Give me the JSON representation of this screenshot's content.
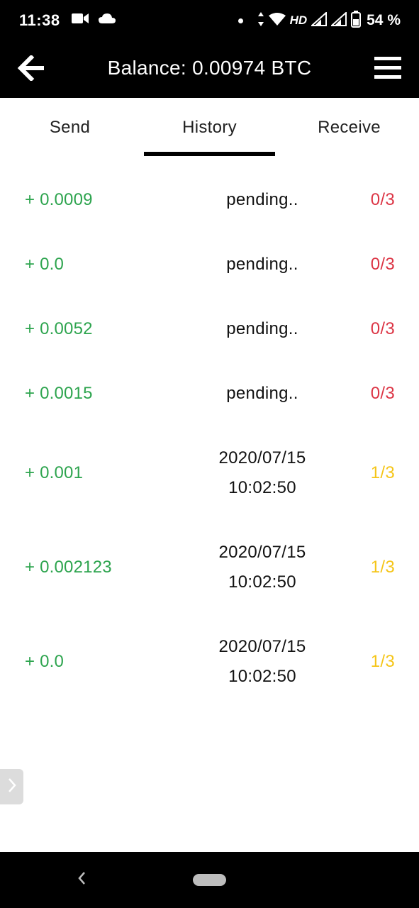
{
  "status_bar": {
    "time": "11:38",
    "hd": "HD",
    "battery": "54 %"
  },
  "app_bar": {
    "title": "Balance: 0.00974 BTC"
  },
  "tabs": [
    {
      "label": "Send",
      "active": false
    },
    {
      "label": "History",
      "active": true
    },
    {
      "label": "Receive",
      "active": false
    }
  ],
  "colors": {
    "amount": "#2da44e",
    "conf_pending": "#dc3545",
    "conf_partial": "#f5c518"
  },
  "transactions": [
    {
      "amount": "+ 0.0009",
      "status": "pending..",
      "confirmations": "0/3",
      "conf_color": "#dc3545"
    },
    {
      "amount": "+ 0.0",
      "status": "pending..",
      "confirmations": "0/3",
      "conf_color": "#dc3545"
    },
    {
      "amount": "+ 0.0052",
      "status": "pending..",
      "confirmations": "0/3",
      "conf_color": "#dc3545"
    },
    {
      "amount": "+ 0.0015",
      "status": "pending..",
      "confirmations": "0/3",
      "conf_color": "#dc3545"
    },
    {
      "amount": "+ 0.001",
      "status": "2020/07/15\n10:02:50",
      "confirmations": "1/3",
      "conf_color": "#f5c518"
    },
    {
      "amount": "+ 0.002123",
      "status": "2020/07/15\n10:02:50",
      "confirmations": "1/3",
      "conf_color": "#f5c518"
    },
    {
      "amount": "+ 0.0",
      "status": "2020/07/15\n10:02:50",
      "confirmations": "1/3",
      "conf_color": "#f5c518"
    }
  ],
  "icons": {
    "back": "arrow-left-icon",
    "menu": "hamburger-menu-icon",
    "edge": "chevron-right-icon",
    "nav_back": "chevron-left-icon"
  }
}
